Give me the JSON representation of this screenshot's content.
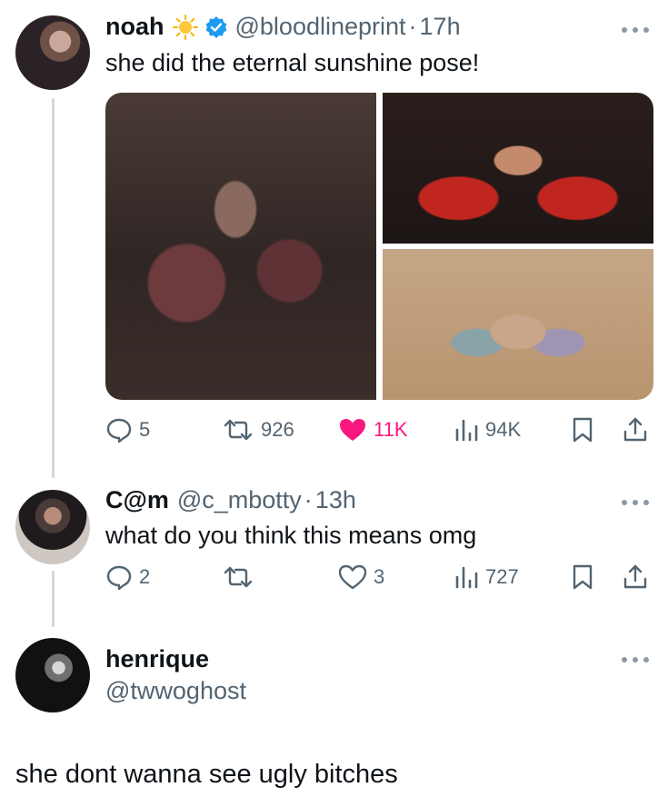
{
  "tweet": {
    "name": "noah",
    "handle": "@bloodlineprint",
    "separator": "·",
    "time": "17h",
    "text": "she did the eternal sunshine pose!",
    "stats": {
      "replies": "5",
      "retweets": "926",
      "likes": "11K",
      "views": "94K"
    },
    "liked": true,
    "colors": {
      "like": "#f91880",
      "verified": "#1d9bf0",
      "muted": "#536471"
    }
  },
  "reply1": {
    "name": "C@m",
    "handle": "@c_mbotty",
    "separator": "·",
    "time": "13h",
    "text": "what do you think this means omg",
    "stats": {
      "replies": "2",
      "retweets": "",
      "likes": "3",
      "views": "727"
    }
  },
  "reply2": {
    "name": "henrique",
    "handle": "@twwoghost",
    "text": "she dont wanna see ugly bitches"
  },
  "icons": [
    "sun-icon",
    "verified-icon",
    "more-icon",
    "reply-icon",
    "retweet-icon",
    "heart-icon",
    "views-icon",
    "bookmark-icon",
    "share-icon"
  ]
}
